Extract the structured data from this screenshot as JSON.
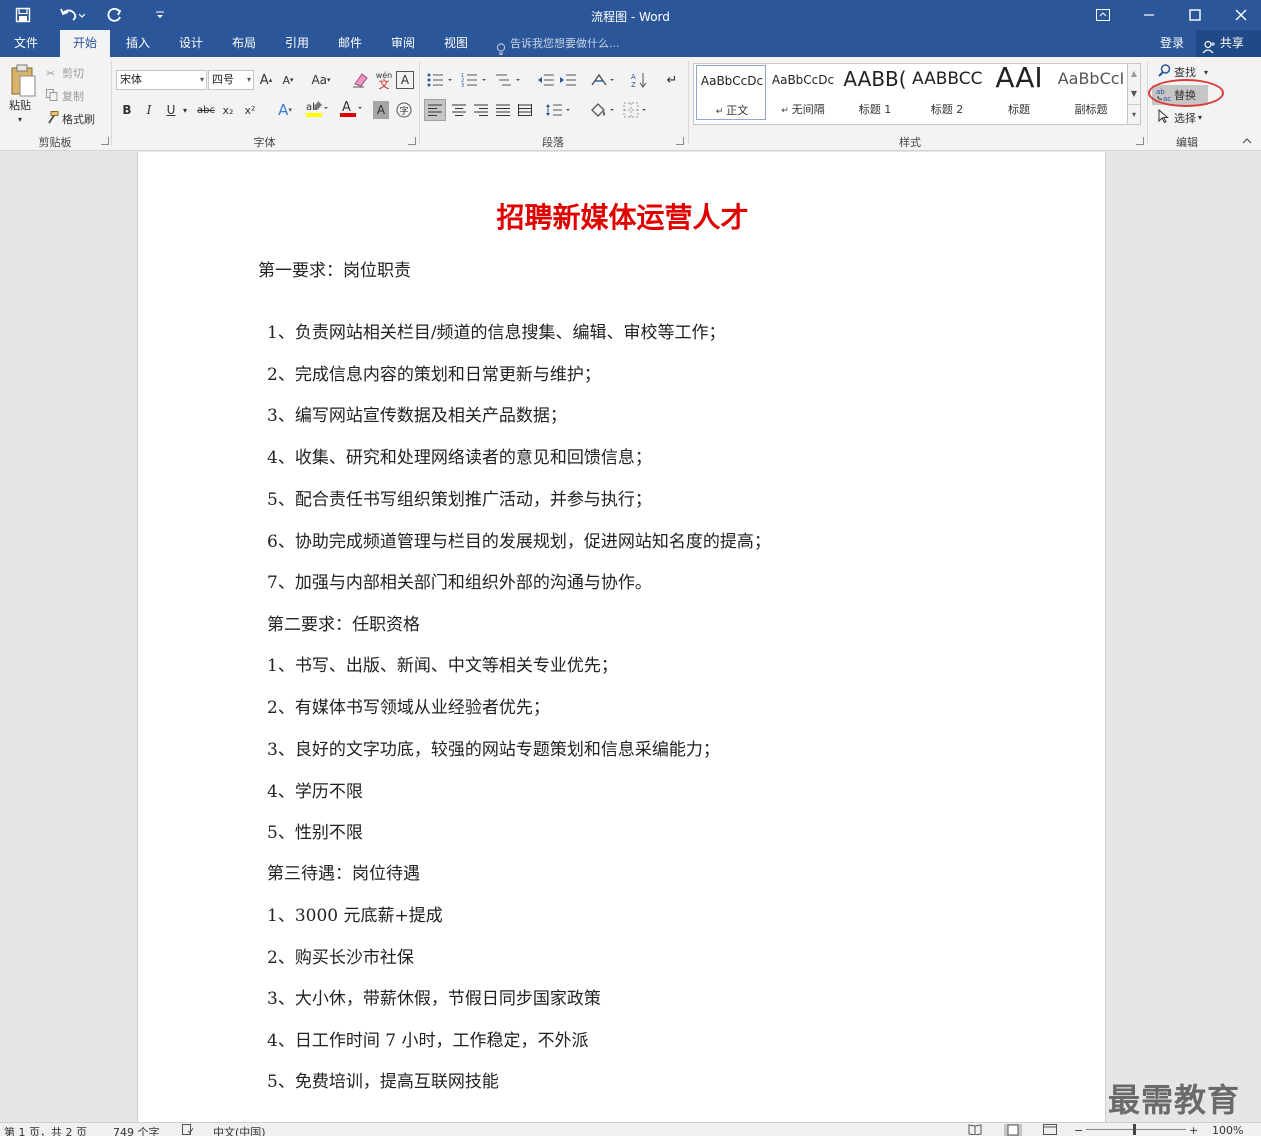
{
  "window": {
    "title": "流程图 - Word",
    "quick_access": {
      "save_icon": "save-icon",
      "undo_icon": "undo-icon",
      "redo_icon": "redo-icon",
      "customize_icon": "customize-icon"
    },
    "controls": [
      "ribbon-display-icon",
      "minimize-icon",
      "maximize-icon",
      "close-icon"
    ]
  },
  "tabs": [
    {
      "label": "文件"
    },
    {
      "label": "开始"
    },
    {
      "label": "插入"
    },
    {
      "label": "设计"
    },
    {
      "label": "布局"
    },
    {
      "label": "引用"
    },
    {
      "label": "邮件"
    },
    {
      "label": "审阅"
    },
    {
      "label": "视图"
    }
  ],
  "tell_me": "告诉我您想要做什么...",
  "account": {
    "login": "登录",
    "share": "共享"
  },
  "ribbon": {
    "clipboard": {
      "label": "剪贴板",
      "paste": "粘贴",
      "cut": "剪切",
      "copy": "复制",
      "format_painter": "格式刷"
    },
    "font": {
      "label": "字体",
      "font_name": "宋体",
      "font_size": "四号",
      "change_case": "Aa",
      "phonetic": "wén",
      "bold": "B",
      "italic": "I",
      "underline": "U",
      "strike": "abc",
      "subscript": "x₂",
      "superscript": "x²"
    },
    "paragraph": {
      "label": "段落"
    },
    "styles": {
      "label": "样式",
      "items": [
        {
          "sample": "AaBbCcDc",
          "name": "正文"
        },
        {
          "sample": "AaBbCcDc",
          "name": "无间隔"
        },
        {
          "sample": "AABB(",
          "name": "标题 1"
        },
        {
          "sample": "AABBCC",
          "name": "标题 2"
        },
        {
          "sample": "AAI",
          "name": "标题"
        },
        {
          "sample": "AaBbCcI",
          "name": "副标题"
        }
      ]
    },
    "editing": {
      "label": "编辑",
      "find": "查找",
      "replace": "替换",
      "select": "选择"
    },
    "highlight_color": "#d93b3b",
    "font_color": "#e00000",
    "highlighter_color": "#ffff00"
  },
  "document": {
    "heading": "招聘新媒体运营人才",
    "paragraphs": [
      "第一要求：岗位职责",
      "1、负责网站相关栏目/频道的信息搜集、编辑、审校等工作；",
      "2、完成信息内容的策划和日常更新与维护；",
      "3、编写网站宣传数据及相关产品数据；",
      "4、收集、研究和处理网络读者的意见和回馈信息；",
      "5、配合责任书写组织策划推广活动，并参与执行；",
      "6、协助完成频道管理与栏目的发展规划，促进网站知名度的提高；",
      "7、加强与内部相关部门和组织外部的沟通与协作。",
      "第二要求：任职资格",
      "1、书写、出版、新闻、中文等相关专业优先；",
      "2、有媒体书写领域从业经验者优先；",
      "3、良好的文字功底，较强的网站专题策划和信息采编能力；",
      "4、学历不限",
      "5、性别不限",
      "第三待遇：岗位待遇",
      "1、3000 元底薪+提成",
      "2、购买长沙市社保",
      "3、大小休，带薪休假，节假日同步国家政策",
      "4、日工作时间 7 小时，工作稳定，不外派",
      "5、免费培训，提高互联网技能"
    ],
    "heading_color": "#e00000"
  },
  "watermark": "最需教育",
  "status": {
    "page": "第 1 页，共 2 页",
    "words": "749 个字",
    "language": "中文(中国)",
    "zoom": "100%"
  },
  "accent_color": "#2b579a"
}
